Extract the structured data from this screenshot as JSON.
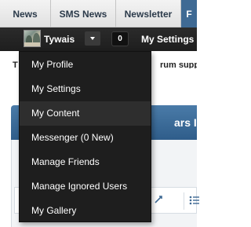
{
  "nav": {
    "tabs": [
      {
        "label": "News"
      },
      {
        "label": "SMS News"
      },
      {
        "label": "Newsletter"
      },
      {
        "label": "F"
      }
    ]
  },
  "userbar": {
    "username": "Tywais",
    "counter": "0",
    "settings_label": "My Settings"
  },
  "page": {
    "notice_lead": "T",
    "notice_tail": "rum suppo",
    "banner_title": "ars In \"V"
  },
  "menu": {
    "items": [
      {
        "label": "My Profile"
      },
      {
        "label": "My Settings"
      },
      {
        "label": "My Content"
      },
      {
        "label": "Messenger (0 New)"
      },
      {
        "label": "Manage Friends"
      },
      {
        "label": "Manage Ignored Users"
      },
      {
        "label": "My Gallery"
      }
    ]
  },
  "toolbar": {
    "icons": [
      "link-icon",
      "list-icon"
    ]
  }
}
